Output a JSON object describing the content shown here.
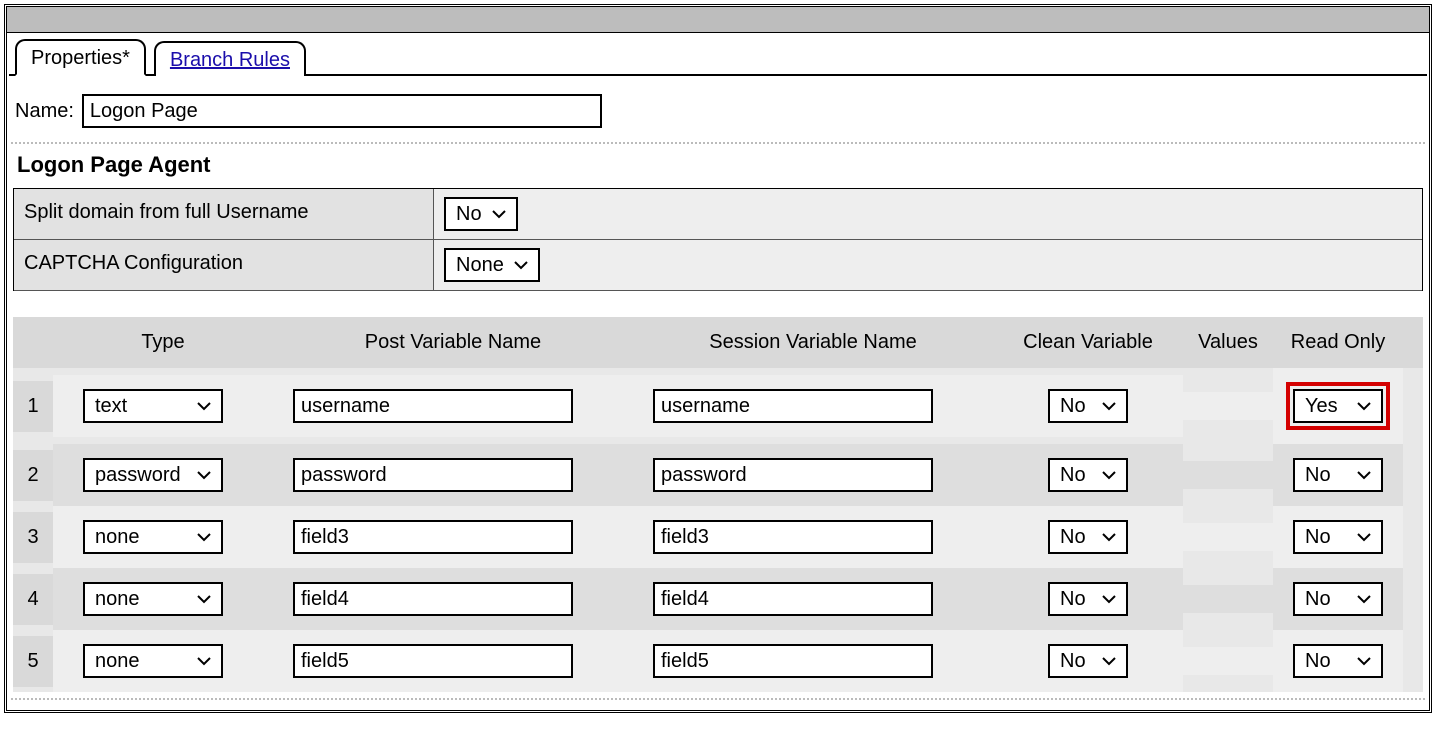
{
  "tabs": {
    "properties": "Properties*",
    "branch_rules": "Branch Rules"
  },
  "name": {
    "label": "Name:",
    "value": "Logon Page"
  },
  "section_title": "Logon Page Agent",
  "settings": {
    "split_domain": {
      "label": "Split domain from full Username",
      "value": "No"
    },
    "captcha": {
      "label": "CAPTCHA Configuration",
      "value": "None"
    }
  },
  "table": {
    "headers": {
      "idx": "",
      "type": "Type",
      "post": "Post Variable Name",
      "session": "Session Variable Name",
      "clean": "Clean Variable",
      "values": "Values",
      "readonly": "Read Only"
    },
    "rows": [
      {
        "n": "1",
        "type": "text",
        "post": "username",
        "session": "username",
        "clean": "No",
        "readonly": "Yes",
        "highlight": true
      },
      {
        "n": "2",
        "type": "password",
        "post": "password",
        "session": "password",
        "clean": "No",
        "readonly": "No"
      },
      {
        "n": "3",
        "type": "none",
        "post": "field3",
        "session": "field3",
        "clean": "No",
        "readonly": "No"
      },
      {
        "n": "4",
        "type": "none",
        "post": "field4",
        "session": "field4",
        "clean": "No",
        "readonly": "No"
      },
      {
        "n": "5",
        "type": "none",
        "post": "field5",
        "session": "field5",
        "clean": "No",
        "readonly": "No"
      }
    ]
  }
}
